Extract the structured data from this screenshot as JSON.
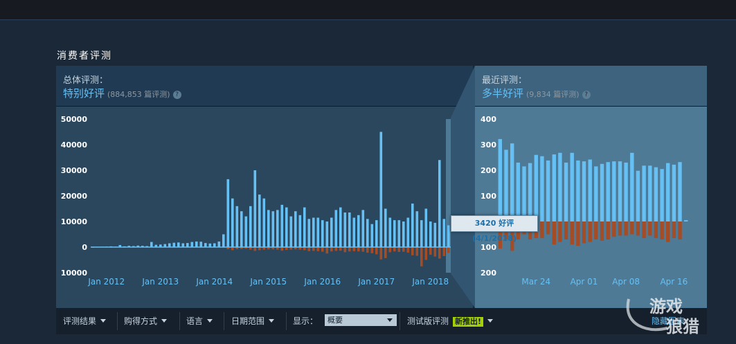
{
  "section_title": "消费者评测",
  "overall": {
    "label": "总体评测：",
    "summary": "特别好评",
    "count": "(884,853 篇评测)",
    "help_icon": "?"
  },
  "recent": {
    "label": "最近评测：",
    "summary": "多半好评",
    "count": "(9,834 篇评测)",
    "help_icon": "?"
  },
  "tooltip": "3420 好评 (4/1/2018)",
  "toolbar": {
    "filter_results": "评测结果",
    "purchase_type": "购得方式",
    "language": "语言",
    "date_range": "日期范围",
    "display_label": "显示：",
    "display_value": "概要",
    "beta_label": "测试版评测",
    "new_badge": "新推出!",
    "hide_graph": "隐藏图表"
  },
  "watermark": {
    "line1": "游戏",
    "line2": "狼猎"
  },
  "colors": {
    "positive": "#66c0f4",
    "negative": "#a34c25",
    "accent": "#66c0f4",
    "badge": "#a4d007"
  },
  "chart_data": [
    {
      "type": "bar",
      "title": "",
      "ylim": [
        -10000,
        50000
      ],
      "y_ticks": [
        50000,
        40000,
        30000,
        20000,
        10000,
        0,
        -10000
      ],
      "y_tick_labels": [
        "50000",
        "40000",
        "30000",
        "20000",
        "10000",
        "0",
        "10000"
      ],
      "x_ticks": [
        "Jan 2012",
        "Jan 2013",
        "Jan 2014",
        "Jan 2015",
        "Jan 2016",
        "Jan 2017",
        "Jan 2018"
      ],
      "x_tick_index": [
        3,
        15,
        27,
        39,
        51,
        63,
        75
      ],
      "series": [
        {
          "values": [
            50,
            100,
            150,
            200,
            300,
            200,
            800,
            300,
            500,
            400,
            600,
            500,
            400,
            2000,
            900,
            1000,
            1200,
            1500,
            1700,
            1800,
            1500,
            1600,
            2000,
            2200,
            2100,
            1600,
            1400,
            1500,
            2200,
            5000,
            26500,
            19000,
            16000,
            14000,
            12000,
            16000,
            30000,
            20500,
            19000,
            14500,
            14000,
            14500,
            16500,
            15500,
            12000,
            14000,
            12500,
            15500,
            11000,
            11500,
            11500,
            10500,
            10000,
            11500,
            14500,
            15500,
            13500,
            13500,
            11500,
            12500,
            14500,
            11000,
            9000,
            10500,
            45000,
            15000,
            11500,
            10500,
            10500,
            10000,
            11500,
            17000,
            14000,
            10500,
            15000,
            10000,
            9500,
            34000,
            11000,
            8500
          ],
          "color": "#66c0f4"
        },
        {
          "values": [
            0,
            0,
            0,
            0,
            0,
            0,
            0,
            0,
            0,
            0,
            0,
            0,
            0,
            0,
            0,
            0,
            0,
            0,
            0,
            0,
            0,
            0,
            0,
            0,
            0,
            0,
            0,
            0,
            0,
            -300,
            -800,
            -1200,
            -800,
            -700,
            -600,
            -1000,
            -1500,
            -1200,
            -1000,
            -900,
            -900,
            -1000,
            -1400,
            -1100,
            -1000,
            -900,
            -1000,
            -1200,
            -1600,
            -1500,
            -1600,
            -1800,
            -2500,
            -1700,
            -1500,
            -1400,
            -2000,
            -1700,
            -1600,
            -1700,
            -1800,
            -2200,
            -2400,
            -2800,
            -4800,
            -4300,
            -2000,
            -1700,
            -1900,
            -1800,
            -2200,
            -3200,
            -3400,
            -7500,
            -5000,
            -3000,
            -3700,
            -4500,
            -3500,
            -2300
          ],
          "color": "#a34c25"
        }
      ]
    },
    {
      "type": "bar",
      "title": "",
      "ylim": [
        -200,
        400
      ],
      "y_ticks": [
        400,
        300,
        200,
        100,
        0,
        -100,
        -200
      ],
      "y_tick_labels": [
        "400",
        "300",
        "200",
        "100",
        "",
        "100",
        "200"
      ],
      "x_ticks": [
        "Mar 24",
        "Apr 01",
        "Apr 08",
        "Apr 16"
      ],
      "x_tick_index": [
        6,
        14,
        21,
        29
      ],
      "series": [
        {
          "values": [
            322,
            280,
            305,
            230,
            215,
            228,
            260,
            255,
            238,
            262,
            268,
            230,
            268,
            238,
            235,
            242,
            215,
            225,
            232,
            235,
            235,
            230,
            268,
            198,
            218,
            218,
            212,
            205,
            228,
            222,
            232,
            5
          ],
          "color": "#66c0f4"
        },
        {
          "values": [
            -105,
            -70,
            -115,
            -70,
            -50,
            -70,
            -65,
            -65,
            -50,
            -90,
            -80,
            -70,
            -90,
            -95,
            -85,
            -80,
            -70,
            -75,
            -70,
            -60,
            -55,
            -55,
            -50,
            -55,
            -65,
            -55,
            -65,
            -70,
            -80,
            -65,
            -70,
            0
          ],
          "color": "#a34c25"
        }
      ]
    }
  ]
}
